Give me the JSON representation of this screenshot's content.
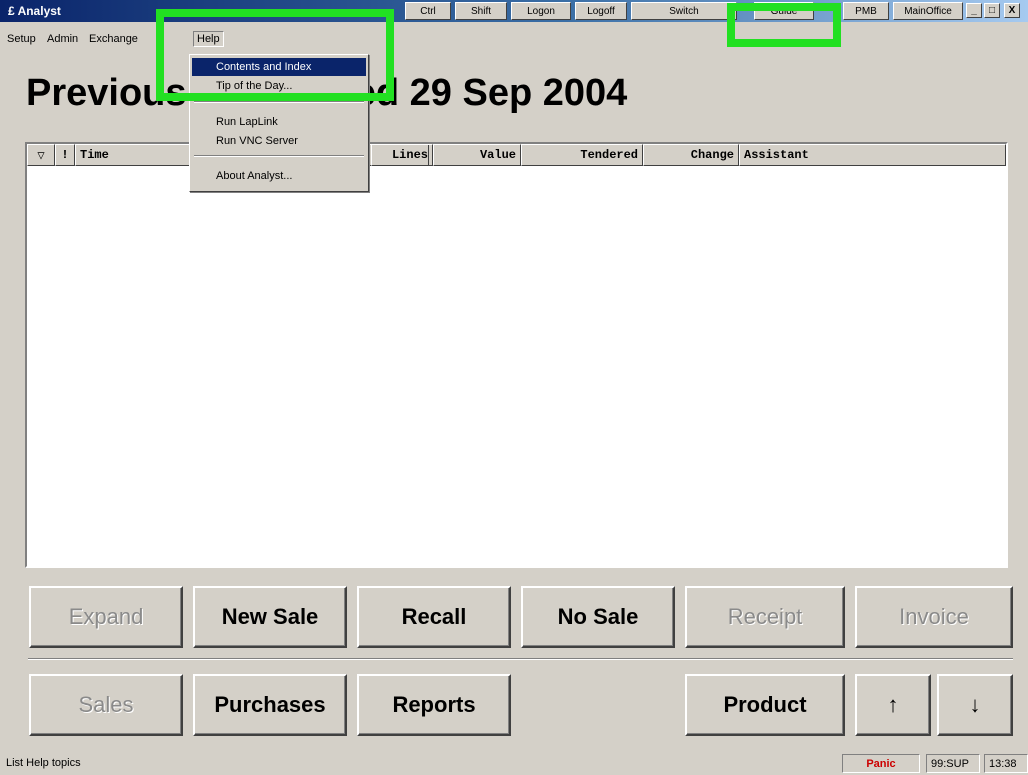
{
  "app": {
    "title": "£ Analyst"
  },
  "toolbar": {
    "buttons": [
      "Ctrl",
      "Shift",
      "Logon",
      "Logoff",
      "Switch",
      "Guide",
      "PMB",
      "MainOffice"
    ],
    "window_controls": [
      "_",
      "□",
      "X"
    ]
  },
  "menubar": {
    "items": [
      "Setup",
      "Admin",
      "Exchange",
      "Help"
    ]
  },
  "help_menu": {
    "items": [
      "Contents and Index",
      "Tip of the Day...",
      "Run LapLink",
      "Run VNC Server",
      "About Analyst..."
    ]
  },
  "heading": {
    "text": "Previous Sales: Wed 29 Sep 2004"
  },
  "grid": {
    "columns": [
      "▽",
      "!",
      "Time",
      "Lines",
      "Value",
      "Tendered",
      "Change",
      "Assistant"
    ]
  },
  "buttons": {
    "row1": [
      "Expand",
      "New Sale",
      "Recall",
      "No Sale",
      "Receipt",
      "Invoice"
    ],
    "row2": [
      "Sales",
      "Purchases",
      "Reports",
      "Product",
      "↑",
      "↓"
    ]
  },
  "statusbar": {
    "text": "List Help topics",
    "panic": "Panic",
    "user": "99:SUP",
    "time": "13:38"
  },
  "colors": {
    "highlight": "#22e022",
    "menu_selection": "#0a246a",
    "panic": "#cc0000"
  }
}
